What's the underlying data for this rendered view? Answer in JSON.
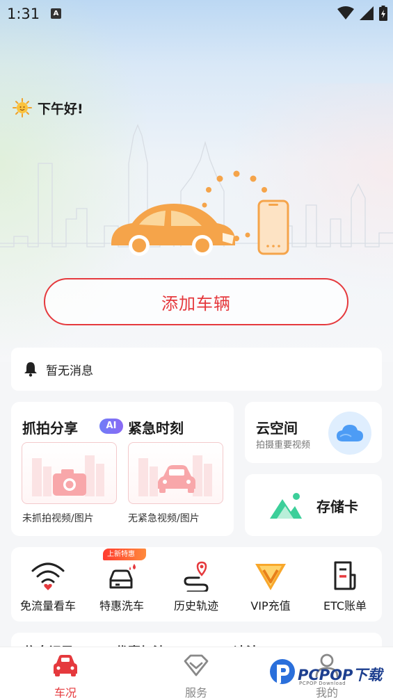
{
  "status_bar": {
    "time": "1:31",
    "notification_icon": "A"
  },
  "greeting": {
    "text": "下午好!",
    "icon": "sun-icon"
  },
  "add_vehicle": {
    "label": "添加车辆"
  },
  "notice": {
    "text": "暂无消息",
    "icon": "bell-icon"
  },
  "capture": {
    "title": "抓拍分享",
    "ai_badge": "AI",
    "emergency_title": "紧急时刻",
    "capture_caption": "未抓拍视频/图片",
    "emergency_caption": "无紧急视频/图片"
  },
  "cloud": {
    "title": "云空间",
    "subtitle": "拍摄重要视频"
  },
  "sd_card": {
    "title": "存储卡"
  },
  "quick_actions": {
    "promo_tag": "上新特惠",
    "items": [
      {
        "label": "免流量看车",
        "icon": "wifi-icon"
      },
      {
        "label": "特惠洗车",
        "icon": "car-wash-icon"
      },
      {
        "label": "历史轨迹",
        "icon": "route-icon"
      },
      {
        "label": "VIP充值",
        "icon": "vip-icon"
      },
      {
        "label": "ETC账单",
        "icon": "etc-bill-icon"
      }
    ]
  },
  "peek": {
    "items": [
      "信息记录",
      "优惠加油",
      "违法"
    ]
  },
  "bottom_nav": {
    "items": [
      {
        "label": "车况",
        "icon": "car-icon",
        "active": true
      },
      {
        "label": "服务",
        "icon": "diamond-icon",
        "active": false
      },
      {
        "label": "我的",
        "icon": "user-icon",
        "active": false
      }
    ]
  },
  "watermark": {
    "text": "PCPOP下载",
    "sub": "PCPOP Download"
  },
  "colors": {
    "accent": "#e5393d",
    "orange": "#f5a44a",
    "inactive": "#888888"
  }
}
